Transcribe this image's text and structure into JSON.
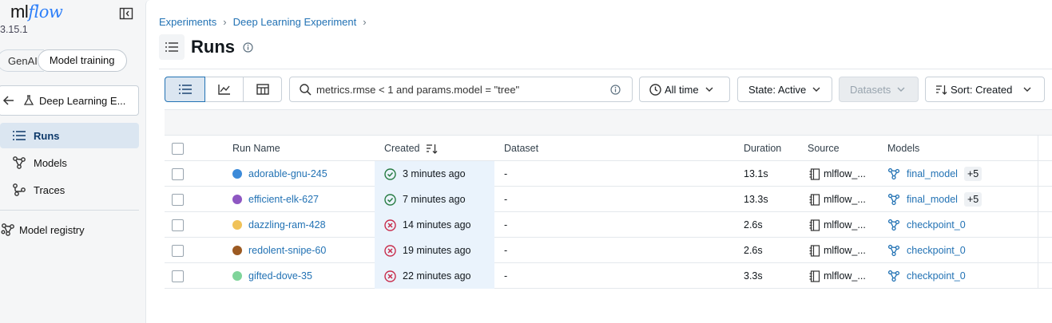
{
  "app": {
    "logo_ml": "ml",
    "logo_flow": "flow",
    "version": "3.15.1"
  },
  "sidebar": {
    "segments": [
      "GenAI",
      "Model training"
    ],
    "experiment_back": "Deep Learning E...",
    "items": [
      {
        "label": "Runs",
        "icon": "list-icon",
        "active": true
      },
      {
        "label": "Models",
        "icon": "models-icon",
        "active": false
      },
      {
        "label": "Traces",
        "icon": "traces-icon",
        "active": false
      }
    ],
    "registry": "Model registry"
  },
  "breadcrumb": {
    "root": "Experiments",
    "experiment": "Deep Learning Experiment"
  },
  "page": {
    "title": "Runs"
  },
  "toolbar": {
    "search_value": "metrics.rmse < 1 and params.model = \"tree\"",
    "time_filter": "All time",
    "state_filter": "State: Active",
    "datasets": "Datasets",
    "sort": "Sort: Created"
  },
  "table": {
    "headers": {
      "run_name": "Run Name",
      "created": "Created",
      "dataset": "Dataset",
      "duration": "Duration",
      "source": "Source",
      "models": "Models"
    },
    "rows": [
      {
        "name": "adorable-gnu-245",
        "color": "#3b8ad9",
        "status": "success",
        "created": "3 minutes ago",
        "dataset": "-",
        "duration": "13.1s",
        "source": "mlflow_...",
        "model": "final_model",
        "extra": "+5"
      },
      {
        "name": "efficient-elk-627",
        "color": "#8e57c2",
        "status": "success",
        "created": "7 minutes ago",
        "dataset": "-",
        "duration": "13.3s",
        "source": "mlflow_...",
        "model": "final_model",
        "extra": "+5"
      },
      {
        "name": "dazzling-ram-428",
        "color": "#f0c259",
        "status": "failed",
        "created": "14 minutes ago",
        "dataset": "-",
        "duration": "2.6s",
        "source": "mlflow_...",
        "model": "checkpoint_0",
        "extra": ""
      },
      {
        "name": "redolent-snipe-60",
        "color": "#9c5a22",
        "status": "failed",
        "created": "19 minutes ago",
        "dataset": "-",
        "duration": "2.6s",
        "source": "mlflow_...",
        "model": "checkpoint_0",
        "extra": ""
      },
      {
        "name": "gifted-dove-35",
        "color": "#7fd49a",
        "status": "failed",
        "created": "22 minutes ago",
        "dataset": "-",
        "duration": "3.3s",
        "source": "mlflow_...",
        "model": "checkpoint_0",
        "extra": ""
      }
    ]
  },
  "colors": {
    "link": "#2272b4",
    "success": "#277c43",
    "failed": "#c82d4c",
    "active_bg": "#dbe6f1"
  }
}
